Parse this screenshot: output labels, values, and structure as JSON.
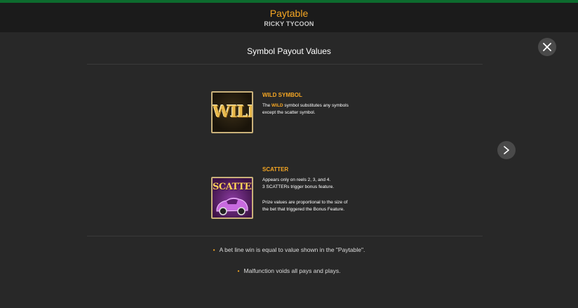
{
  "header": {
    "title": "Paytable",
    "subtitle": "RICKY TYCOON"
  },
  "section_title": "Symbol Payout Values",
  "symbols": {
    "wild": {
      "image_text": "WILD",
      "heading": "WILD SYMBOL",
      "text_before": "The ",
      "highlight": "WILD",
      "text_after": " symbol substitutes any symbols",
      "line2": "except the scatter symbol."
    },
    "scatter": {
      "image_text": "SCATTER",
      "heading": "SCATTER",
      "lines": [
        "Appears only on reels 2, 3, and 4.",
        "3 SCATTERs trigger bonus feature."
      ],
      "prize_lines": [
        "Prize values are proportional to the size of",
        "the bet that triggered the Bonus Feature."
      ]
    }
  },
  "notes": [
    "A bet line win is equal to value shown in the \"Paytable\".",
    "Malfunction voids all pays and plays."
  ],
  "colors": {
    "accent": "#f5a623",
    "stripe": "#0d6b2e",
    "background": "#282828"
  },
  "icons": {
    "close": "close-icon",
    "next": "chevron-right-icon"
  }
}
